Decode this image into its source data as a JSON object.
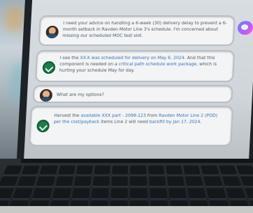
{
  "chat": {
    "messages": [
      {
        "role": "user",
        "text": "I need your advice on handling a 6-week (30) delivery delay to prevent a 6-month setback in Ravden Motor Line 3's schedule. I'm concerned about missing our scheduled MOC test slot."
      },
      {
        "role": "assistant",
        "text_before": "I see the ",
        "link1": "XX-X was scheduled for delivery on May 6, 2024.",
        "text_middle": " And that this component is needed on a ",
        "link2": "critical path schedule work package",
        "text_after": ", which is hurting your schedule May for day."
      },
      {
        "role": "user",
        "text": "What are my options?"
      },
      {
        "role": "assistant",
        "text_before": "Harvest the ",
        "link1": "available XXX part - 2098-123",
        "text_middle": " from ",
        "link2": "Ravden Motor Line 2 (POD) per the cost/payback",
        "text_after": " items Line 2 will need ",
        "link3": "backfill by Jan 17, 2024."
      }
    ]
  },
  "colors": {
    "bubble_bg": "#f3f4f5",
    "link": "#2f6fb6",
    "bot_avatar": "#1f7a4a",
    "logo_gradient": [
      "#5e8bff",
      "#b35cff",
      "#ff5fbf"
    ]
  },
  "icons": {
    "user_avatar": "user-avatar-icon",
    "bot_avatar": "checkmark-bot-icon",
    "app_logo": "app-logo-icon"
  }
}
